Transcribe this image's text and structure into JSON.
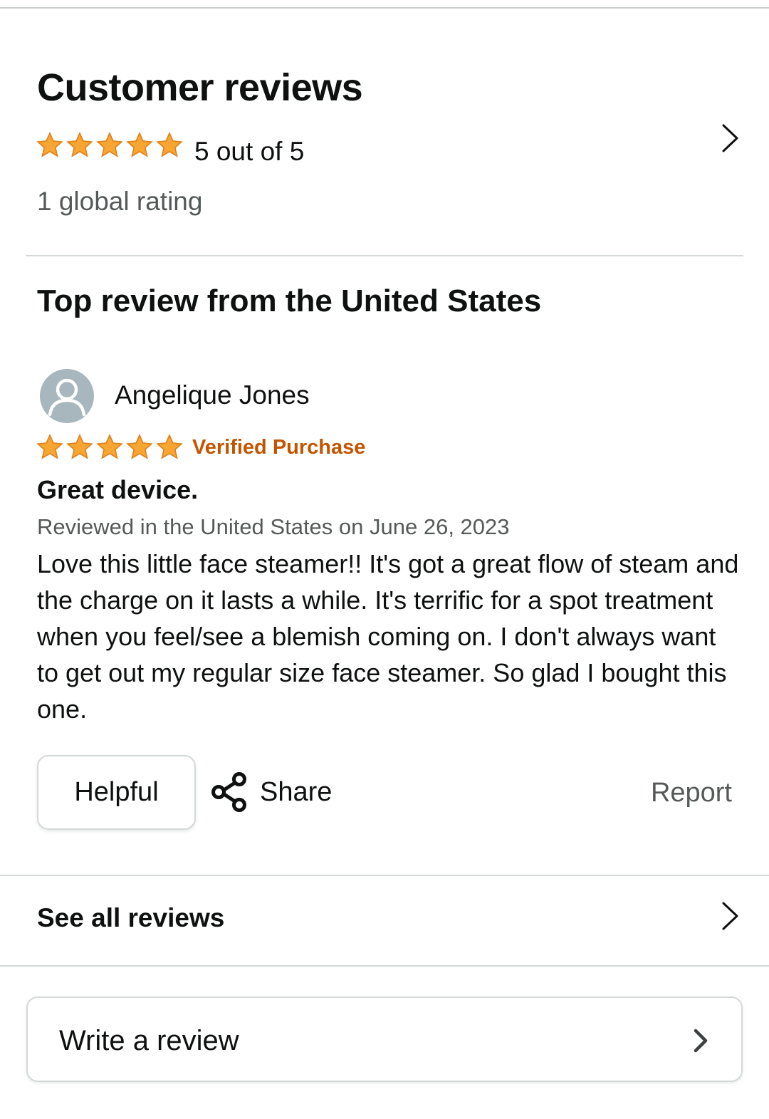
{
  "reviews_section": {
    "title": "Customer reviews",
    "rating_stars": 5,
    "rating_text": "5 out of 5",
    "global_rating": "1 global rating",
    "star_color": "#f7a533"
  },
  "top_review": {
    "heading": "Top review from the United States",
    "reviewer_name": "Angelique Jones",
    "stars": 5,
    "verified_label": "Verified Purchase",
    "verified_color": "#c45500",
    "title": "Great device.",
    "date_text": "Reviewed in the United States on June 26, 2023",
    "body": "Love this little face steamer!! It's got a great flow of steam and the charge on it lasts a while. It's terrific for a spot treatment when you feel/see a blemish coming on. I don't always want to get out my regular size face steamer. So glad I bought this one."
  },
  "actions": {
    "helpful_label": "Helpful",
    "share_label": "Share",
    "report_label": "Report"
  },
  "see_all": {
    "label": "See all reviews"
  },
  "write_review": {
    "label": "Write a review"
  },
  "icons": {
    "star": "star-icon",
    "chevron": "chevron-right-icon",
    "share": "share-icon",
    "avatar": "user-avatar-icon"
  }
}
